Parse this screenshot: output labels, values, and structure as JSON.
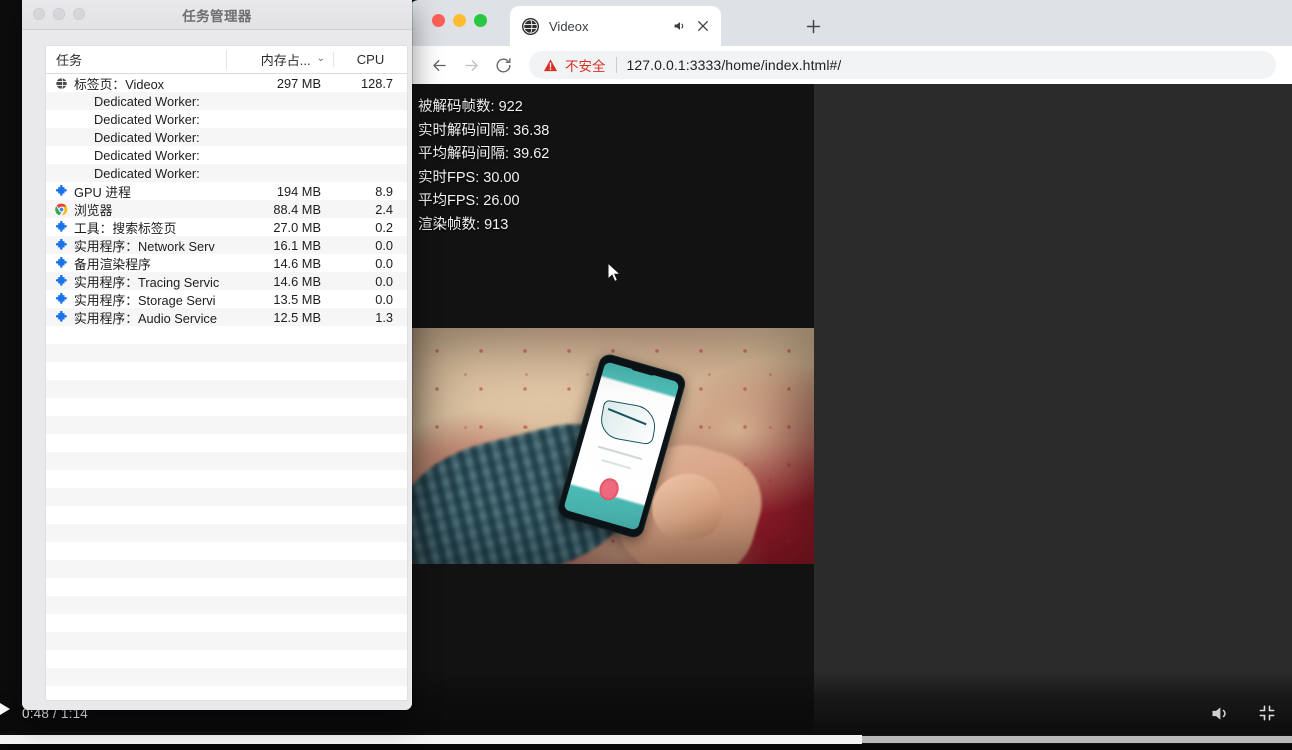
{
  "browser": {
    "traffic_lights": [
      "close",
      "minimize",
      "maximize"
    ],
    "tab": {
      "title": "Videox",
      "favicon": "globe-icon",
      "audio_indicator": "speaker-icon",
      "close": "close-icon"
    },
    "new_tab_label": "+",
    "nav": {
      "back": "back-arrow-icon",
      "forward": "forward-arrow-icon",
      "reload": "reload-icon"
    },
    "omnibox": {
      "warning_icon": "warning-triangle-icon",
      "security_label": "不安全",
      "url": "127.0.0.1:3333/home/index.html#/"
    }
  },
  "task_manager": {
    "title": "任务管理器",
    "columns": {
      "task": "任务",
      "memory": "内存占...",
      "cpu": "CPU",
      "sort_caret": "⌄"
    },
    "rows": [
      {
        "icon": "globe-icon",
        "indent": false,
        "name": "标签页：Videox",
        "memory": "297 MB",
        "cpu": "128.7"
      },
      {
        "icon": "none",
        "indent": true,
        "name": "Dedicated Worker:",
        "memory": "",
        "cpu": ""
      },
      {
        "icon": "none",
        "indent": true,
        "name": "Dedicated Worker:",
        "memory": "",
        "cpu": ""
      },
      {
        "icon": "none",
        "indent": true,
        "name": "Dedicated Worker:",
        "memory": "",
        "cpu": ""
      },
      {
        "icon": "none",
        "indent": true,
        "name": "Dedicated Worker:",
        "memory": "",
        "cpu": ""
      },
      {
        "icon": "none",
        "indent": true,
        "name": "Dedicated Worker:",
        "memory": "",
        "cpu": ""
      },
      {
        "icon": "puzzle-icon",
        "indent": false,
        "name": "GPU 进程",
        "memory": "194 MB",
        "cpu": "8.9"
      },
      {
        "icon": "chrome-icon",
        "indent": false,
        "name": "浏览器",
        "memory": "88.4 MB",
        "cpu": "2.4"
      },
      {
        "icon": "puzzle-icon",
        "indent": false,
        "name": "工具：搜索标签页",
        "memory": "27.0 MB",
        "cpu": "0.2"
      },
      {
        "icon": "puzzle-icon",
        "indent": false,
        "name": "实用程序：Network Serv",
        "memory": "16.1 MB",
        "cpu": "0.0"
      },
      {
        "icon": "puzzle-icon",
        "indent": false,
        "name": "备用渲染程序",
        "memory": "14.6 MB",
        "cpu": "0.0"
      },
      {
        "icon": "puzzle-icon",
        "indent": false,
        "name": "实用程序：Tracing Servic",
        "memory": "14.6 MB",
        "cpu": "0.0"
      },
      {
        "icon": "puzzle-icon",
        "indent": false,
        "name": "实用程序：Storage Servi",
        "memory": "13.5 MB",
        "cpu": "0.0"
      },
      {
        "icon": "puzzle-icon",
        "indent": false,
        "name": "实用程序：Audio Service",
        "memory": "12.5 MB",
        "cpu": "1.3"
      }
    ],
    "empty_row_count": 22
  },
  "player": {
    "stats": [
      {
        "label": "被解码帧数",
        "value": "922"
      },
      {
        "label": "实时解码间隔",
        "value": "36.38"
      },
      {
        "label": "平均解码间隔",
        "value": "39.62"
      },
      {
        "label": "实时FPS",
        "value": "30.00"
      },
      {
        "label": "平均FPS",
        "value": "26.00"
      },
      {
        "label": "渲染帧数",
        "value": "913"
      }
    ],
    "time_display": "0:48 / 1:14",
    "current_time": "0:48",
    "duration": "1:14",
    "play_state": "playing",
    "volume_icon": "speaker-icon",
    "fullscreen_icon": "exit-fullscreen-icon"
  },
  "colors": {
    "chrome_tabstrip": "#dee1e6",
    "chrome_toolbar": "#ffffff",
    "omnibox_bg": "#f1f3f4",
    "insecure_red": "#d93025",
    "taskmgr_chrome": "#e9e9ec",
    "page_gutter": "#2b2b2b",
    "video_bg": "#121212"
  }
}
